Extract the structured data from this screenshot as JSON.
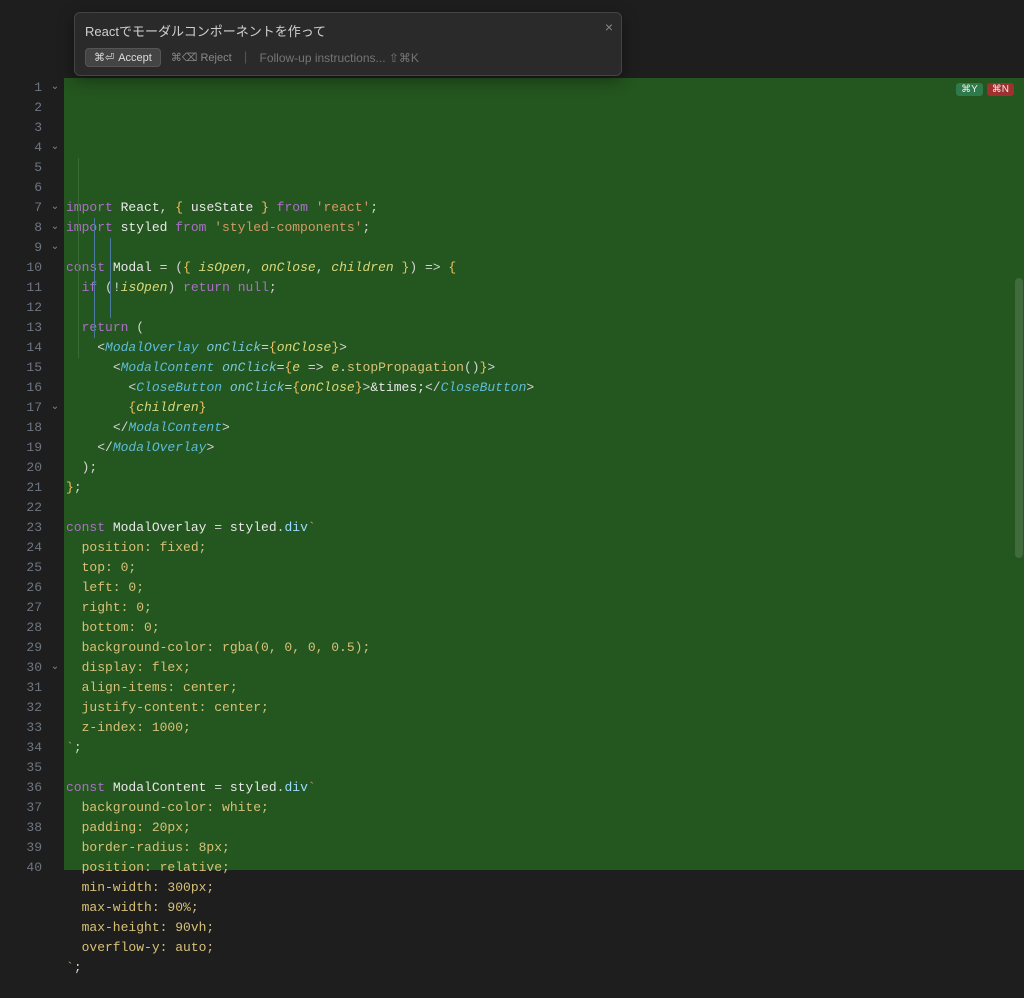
{
  "ai_panel": {
    "title": "Reactでモーダルコンポーネントを作って",
    "accept_kbd": "⌘⏎",
    "accept_label": "Accept",
    "reject_kbd": "⌘⌫",
    "reject_label": "Reject",
    "followup_placeholder": "Follow-up instructions... ⇧⌘K",
    "close_glyph": "×"
  },
  "badges": {
    "yes": "⌘Y",
    "no": "⌘N"
  },
  "gutter": {
    "start": 1,
    "end": 40,
    "foldable_lines": [
      1,
      4,
      7,
      8,
      9,
      17,
      30
    ]
  },
  "code_lines": [
    [
      [
        "k",
        "import "
      ],
      [
        "def",
        "React"
      ],
      [
        "pun",
        ", "
      ],
      [
        "br",
        "{ "
      ],
      [
        "def",
        "useState"
      ],
      [
        "br",
        " }"
      ],
      [
        "k",
        " from "
      ],
      [
        "str",
        "'react'"
      ],
      [
        "pun",
        ";"
      ]
    ],
    [
      [
        "k",
        "import "
      ],
      [
        "def",
        "styled"
      ],
      [
        "k",
        " from "
      ],
      [
        "str",
        "'styled-components'"
      ],
      [
        "pun",
        ";"
      ]
    ],
    [],
    [
      [
        "k",
        "const "
      ],
      [
        "def",
        "Modal"
      ],
      [
        "op",
        " = "
      ],
      [
        "pun",
        "("
      ],
      [
        "br",
        "{ "
      ],
      [
        "fn",
        "isOpen"
      ],
      [
        "pun",
        ", "
      ],
      [
        "fn",
        "onClose"
      ],
      [
        "pun",
        ", "
      ],
      [
        "fn",
        "children"
      ],
      [
        "br",
        " }"
      ],
      [
        "pun",
        ")"
      ],
      [
        "op",
        " => "
      ],
      [
        "br",
        "{"
      ]
    ],
    [
      [
        "pun",
        "  "
      ],
      [
        "k",
        "if "
      ],
      [
        "pun",
        "("
      ],
      [
        "op",
        "!"
      ],
      [
        "fn",
        "isOpen"
      ],
      [
        "pun",
        ")"
      ],
      [
        "k",
        " return "
      ],
      [
        "null",
        "null"
      ],
      [
        "pun",
        ";"
      ]
    ],
    [],
    [
      [
        "pun",
        "  "
      ],
      [
        "k",
        "return "
      ],
      [
        "pun",
        "("
      ]
    ],
    [
      [
        "pun",
        "    "
      ],
      [
        "pun",
        "<"
      ],
      [
        "jsx",
        "ModalOverlay"
      ],
      [
        "pun",
        " "
      ],
      [
        "attr",
        "onClick"
      ],
      [
        "op",
        "="
      ],
      [
        "br",
        "{"
      ],
      [
        "fn",
        "onClose"
      ],
      [
        "br",
        "}"
      ],
      [
        "pun",
        ">"
      ]
    ],
    [
      [
        "pun",
        "      "
      ],
      [
        "pun",
        "<"
      ],
      [
        "jsx",
        "ModalContent"
      ],
      [
        "pun",
        " "
      ],
      [
        "attr",
        "onClick"
      ],
      [
        "op",
        "="
      ],
      [
        "br",
        "{"
      ],
      [
        "fn",
        "e"
      ],
      [
        "op",
        " => "
      ],
      [
        "fn",
        "e"
      ],
      [
        "pun",
        "."
      ],
      [
        "call",
        "stopPropagation"
      ],
      [
        "pun",
        "()"
      ],
      [
        "br",
        "}"
      ],
      [
        "pun",
        ">"
      ]
    ],
    [
      [
        "pun",
        "        "
      ],
      [
        "pun",
        "<"
      ],
      [
        "jsx",
        "CloseButton"
      ],
      [
        "pun",
        " "
      ],
      [
        "attr",
        "onClick"
      ],
      [
        "op",
        "="
      ],
      [
        "br",
        "{"
      ],
      [
        "fn",
        "onClose"
      ],
      [
        "br",
        "}"
      ],
      [
        "pun",
        ">"
      ],
      [
        "def",
        "&times;"
      ],
      [
        "pun",
        "</"
      ],
      [
        "jsx",
        "CloseButton"
      ],
      [
        "pun",
        ">"
      ]
    ],
    [
      [
        "pun",
        "        "
      ],
      [
        "br",
        "{"
      ],
      [
        "fn",
        "children"
      ],
      [
        "br",
        "}"
      ]
    ],
    [
      [
        "pun",
        "      "
      ],
      [
        "pun",
        "</"
      ],
      [
        "jsx",
        "ModalContent"
      ],
      [
        "pun",
        ">"
      ]
    ],
    [
      [
        "pun",
        "    "
      ],
      [
        "pun",
        "</"
      ],
      [
        "jsx",
        "ModalOverlay"
      ],
      [
        "pun",
        ">"
      ]
    ],
    [
      [
        "pun",
        "  );"
      ]
    ],
    [
      [
        "br",
        "}"
      ],
      [
        "pun",
        ";"
      ]
    ],
    [],
    [
      [
        "k",
        "const "
      ],
      [
        "def",
        "ModalOverlay"
      ],
      [
        "op",
        " = "
      ],
      [
        "def",
        "styled"
      ],
      [
        "pun",
        "."
      ],
      [
        "prop",
        "div"
      ],
      [
        "str",
        "`"
      ]
    ],
    [
      [
        "css",
        "  position: fixed;"
      ]
    ],
    [
      [
        "css",
        "  top: 0;"
      ]
    ],
    [
      [
        "css",
        "  left: 0;"
      ]
    ],
    [
      [
        "css",
        "  right: 0;"
      ]
    ],
    [
      [
        "css",
        "  bottom: 0;"
      ]
    ],
    [
      [
        "css",
        "  background-color: rgba(0, 0, 0, 0.5);"
      ]
    ],
    [
      [
        "css",
        "  display: flex;"
      ]
    ],
    [
      [
        "css",
        "  align-items: center;"
      ]
    ],
    [
      [
        "css",
        "  justify-content: center;"
      ]
    ],
    [
      [
        "css",
        "  z-index: 1000;"
      ]
    ],
    [
      [
        "str",
        "`"
      ],
      [
        "pun",
        ";"
      ]
    ],
    [],
    [
      [
        "k",
        "const "
      ],
      [
        "def",
        "ModalContent"
      ],
      [
        "op",
        " = "
      ],
      [
        "def",
        "styled"
      ],
      [
        "pun",
        "."
      ],
      [
        "prop",
        "div"
      ],
      [
        "str",
        "`"
      ]
    ],
    [
      [
        "css",
        "  background-color: white;"
      ]
    ],
    [
      [
        "css",
        "  padding: 20px;"
      ]
    ],
    [
      [
        "css",
        "  border-radius: 8px;"
      ]
    ],
    [
      [
        "css",
        "  position: relative;"
      ]
    ],
    [
      [
        "css",
        "  min-width: 300px;"
      ]
    ],
    [
      [
        "css",
        "  max-width: 90%;"
      ]
    ],
    [
      [
        "css",
        "  max-height: 90vh;"
      ]
    ],
    [
      [
        "css",
        "  overflow-y: auto;"
      ]
    ],
    [
      [
        "str",
        "`"
      ],
      [
        "pun",
        ";"
      ]
    ],
    []
  ]
}
